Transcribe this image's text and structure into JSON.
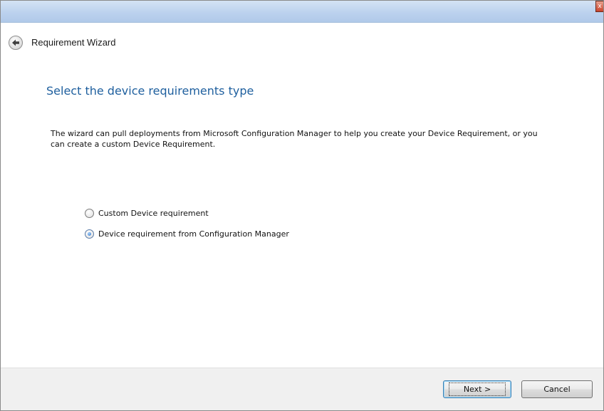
{
  "window": {
    "close_glyph": "x"
  },
  "header": {
    "back_icon": "back-arrow-icon",
    "title": "Requirement Wizard"
  },
  "main": {
    "heading": "Select the device requirements type",
    "description": "The wizard can pull deployments from Microsoft Configuration Manager to help you create your Device Requirement, or you can create a custom Device Requirement.",
    "options": [
      {
        "label": "Custom Device requirement",
        "selected": false
      },
      {
        "label": "Device requirement from Configuration Manager",
        "selected": true
      }
    ]
  },
  "footer": {
    "next_label": "Next >",
    "cancel_label": "Cancel"
  },
  "colors": {
    "heading": "#1e5f9e",
    "titlebar": "#bcd2ee",
    "footer": "#f0f0f0"
  }
}
